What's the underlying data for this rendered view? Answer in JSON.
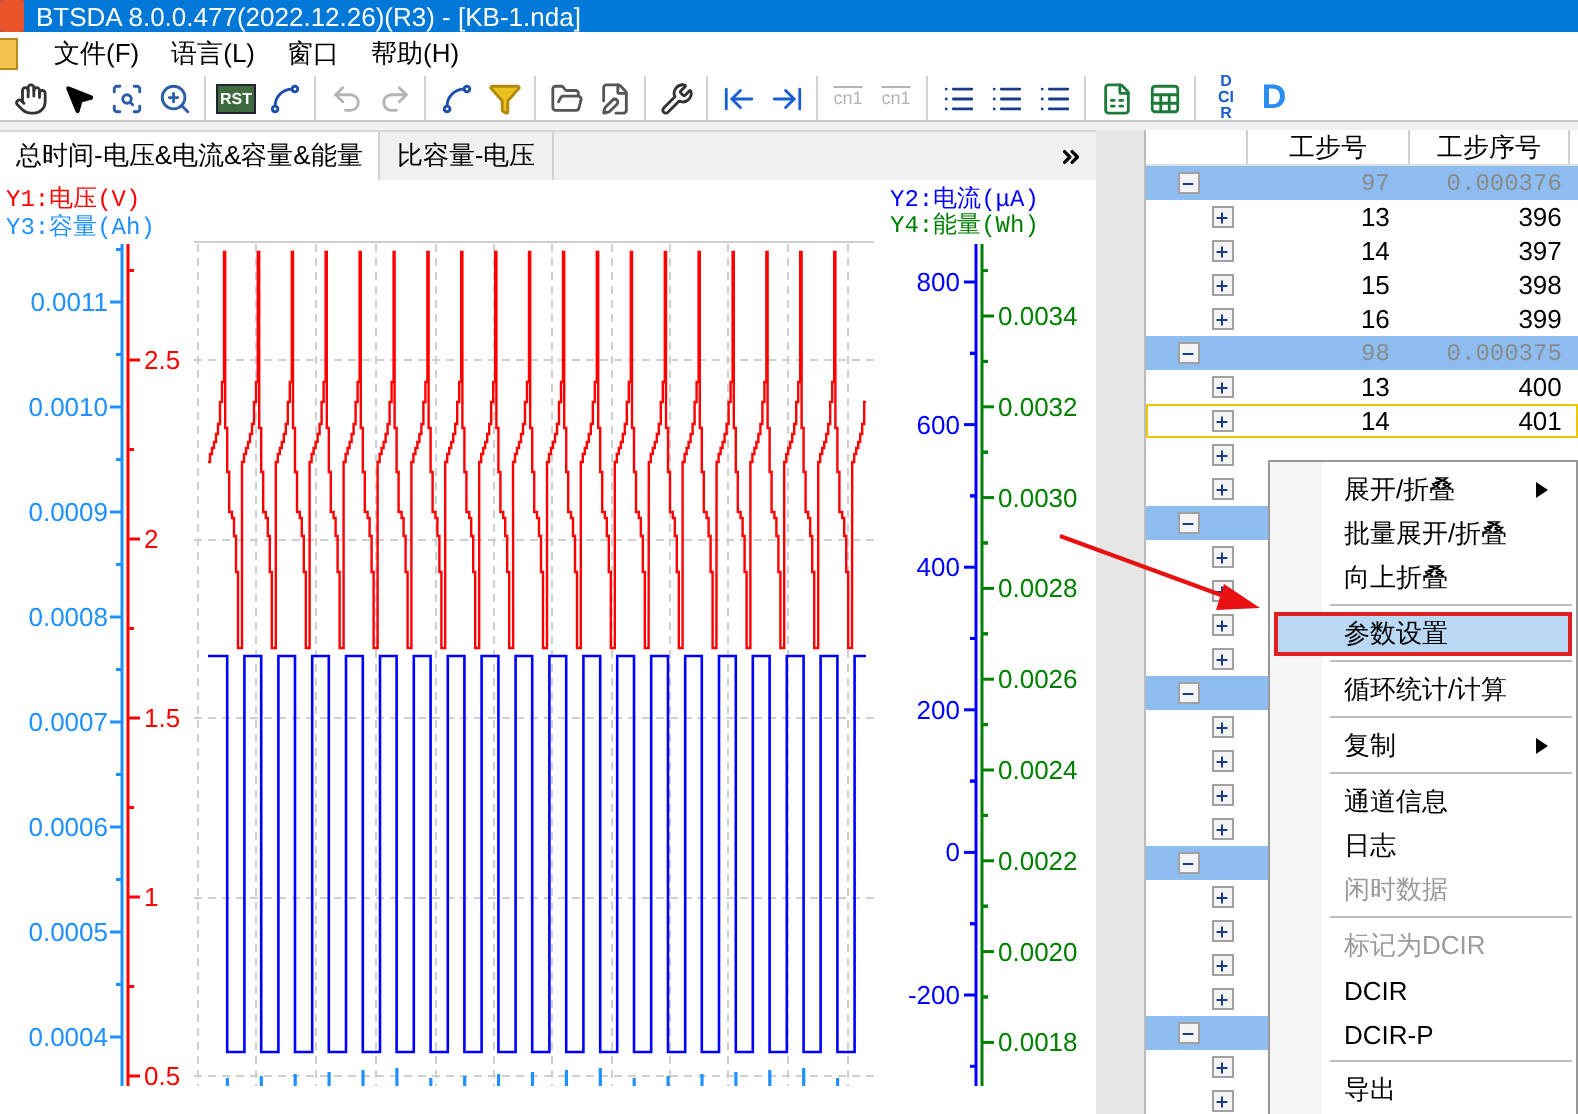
{
  "window": {
    "title": "BTSDA 8.0.0.477(2022.12.26)(R3) - [KB-1.nda]"
  },
  "menu": [
    "文件(F)",
    "语言(L)",
    "窗口",
    "帮助(H)"
  ],
  "toolbar": [
    [
      {
        "kind": "hand",
        "disabled": false
      },
      {
        "kind": "pointer",
        "disabled": false
      },
      {
        "kind": "zoom-box",
        "disabled": false
      },
      {
        "kind": "zoom",
        "disabled": false
      }
    ],
    [
      {
        "kind": "badge",
        "label": "RST",
        "disabled": false
      },
      {
        "kind": "chart",
        "disabled": false
      }
    ],
    [
      {
        "kind": "undo",
        "disabled": true
      },
      {
        "kind": "redo",
        "disabled": true
      }
    ],
    [
      {
        "kind": "line",
        "disabled": false
      },
      {
        "kind": "filter",
        "disabled": false
      }
    ],
    [
      {
        "kind": "folder",
        "disabled": false
      },
      {
        "kind": "save",
        "disabled": false
      }
    ],
    [
      {
        "kind": "wrench",
        "disabled": false
      }
    ],
    [
      {
        "kind": "first",
        "disabled": false
      },
      {
        "kind": "last",
        "disabled": false
      }
    ],
    [
      {
        "kind": "caption",
        "label": "cn1",
        "disabled": true
      },
      {
        "kind": "caption",
        "label": "cn1",
        "disabled": true
      }
    ],
    [
      {
        "kind": "list",
        "disabled": false
      },
      {
        "kind": "list",
        "disabled": false
      },
      {
        "kind": "list",
        "disabled": false
      }
    ],
    [
      {
        "kind": "excel",
        "disabled": false
      },
      {
        "kind": "sheet",
        "disabled": false
      }
    ],
    [
      {
        "kind": "stacked",
        "label": "DCIR",
        "disabled": false
      },
      {
        "kind": "letter",
        "label": "D",
        "disabled": false
      }
    ]
  ],
  "tabs": [
    {
      "label": "总时间-电压&电流&容量&能量",
      "selected": true
    },
    {
      "label": "比容量-电压",
      "selected": false
    }
  ],
  "chart": {
    "axes": [
      {
        "kind": "y1",
        "title": "Y1:电压(V)",
        "color": "#ff0000",
        "ticks": [
          "2.5",
          "2",
          "1.5",
          "1",
          "0.5"
        ]
      },
      {
        "kind": "y3",
        "title": "Y3:容量(Ah)",
        "color": "#1e90ff",
        "ticks": [
          "0.0011",
          "0.0010",
          "0.0009",
          "0.0008",
          "0.0007",
          "0.0006",
          "0.0005",
          "0.0004"
        ]
      },
      {
        "kind": "y2",
        "title": "Y2:电流(μA)",
        "color": "#0000ff",
        "ticks": [
          "800",
          "600",
          "400",
          "200",
          "0",
          "-200"
        ]
      },
      {
        "kind": "y4",
        "title": "Y4:能量(Wh)",
        "color": "#008000",
        "ticks": [
          "0.0034",
          "0.0032",
          "0.0030",
          "0.0028",
          "0.0026",
          "0.0024",
          "0.0022",
          "0.0020",
          "0.0018"
        ]
      }
    ]
  },
  "step_table": {
    "columns": [
      "工步号",
      "工步序号"
    ],
    "groups": [
      {
        "cycle": "97",
        "value": "0.000376",
        "expanded": true,
        "children": [
          {
            "step": "13",
            "index": "396",
            "expanded": false,
            "selected": false
          },
          {
            "step": "14",
            "index": "397",
            "expanded": false,
            "selected": false
          },
          {
            "step": "15",
            "index": "398",
            "expanded": false,
            "selected": false
          },
          {
            "step": "16",
            "index": "399",
            "expanded": false,
            "selected": false
          }
        ]
      },
      {
        "cycle": "98",
        "value": "0.000375",
        "expanded": true,
        "children": [
          {
            "step": "13",
            "index": "400",
            "expanded": false,
            "selected": false
          },
          {
            "step": "14",
            "index": "401",
            "expanded": false,
            "selected": true
          },
          {
            "expanded": false,
            "selected": false
          },
          {
            "expanded": false,
            "selected": false
          }
        ]
      },
      {
        "expanded": true,
        "children": [
          {
            "expanded": false,
            "selected": false
          },
          {
            "expanded": false,
            "selected": false
          },
          {
            "expanded": false,
            "selected": false
          },
          {
            "expanded": false,
            "selected": false
          }
        ]
      },
      {
        "expanded": true,
        "children": [
          {
            "expanded": false,
            "selected": false
          },
          {
            "expanded": false,
            "selected": false
          },
          {
            "expanded": false,
            "selected": false
          },
          {
            "expanded": false,
            "selected": false
          }
        ]
      },
      {
        "expanded": true,
        "children": [
          {
            "expanded": false,
            "selected": false
          },
          {
            "expanded": false,
            "selected": false
          },
          {
            "expanded": false,
            "selected": false
          },
          {
            "expanded": false,
            "selected": false
          }
        ]
      },
      {
        "expanded": true,
        "children": [
          {
            "expanded": false,
            "selected": false
          },
          {
            "expanded": false,
            "selected": false
          }
        ]
      }
    ]
  },
  "context_menu": {
    "items": [
      {
        "kind": "item",
        "label": "展开/折叠",
        "submenu": true,
        "disabled": false,
        "selected": false
      },
      {
        "kind": "item",
        "label": "批量展开/折叠",
        "submenu": false,
        "disabled": false,
        "selected": false
      },
      {
        "kind": "item",
        "label": "向上折叠",
        "submenu": false,
        "disabled": false,
        "selected": false
      },
      {
        "kind": "separator"
      },
      {
        "kind": "item",
        "label": "参数设置",
        "submenu": false,
        "disabled": false,
        "selected": true
      },
      {
        "kind": "separator"
      },
      {
        "kind": "item",
        "label": "循环统计/计算",
        "submenu": false,
        "disabled": false,
        "selected": false
      },
      {
        "kind": "separator"
      },
      {
        "kind": "item",
        "label": "复制",
        "submenu": true,
        "disabled": false,
        "selected": false
      },
      {
        "kind": "separator"
      },
      {
        "kind": "item",
        "label": "通道信息",
        "submenu": false,
        "disabled": false,
        "selected": false
      },
      {
        "kind": "item",
        "label": "日志",
        "submenu": false,
        "disabled": false,
        "selected": false
      },
      {
        "kind": "item",
        "label": "闲时数据",
        "submenu": false,
        "disabled": true,
        "selected": false
      },
      {
        "kind": "separator"
      },
      {
        "kind": "item",
        "label": "标记为DCIR",
        "submenu": false,
        "disabled": true,
        "selected": false
      },
      {
        "kind": "item",
        "label": "DCIR",
        "submenu": false,
        "disabled": false,
        "selected": false
      },
      {
        "kind": "item",
        "label": "DCIR-P",
        "submenu": false,
        "disabled": false,
        "selected": false
      },
      {
        "kind": "separator"
      },
      {
        "kind": "item",
        "label": "导出",
        "submenu": false,
        "disabled": false,
        "selected": false
      }
    ]
  }
}
